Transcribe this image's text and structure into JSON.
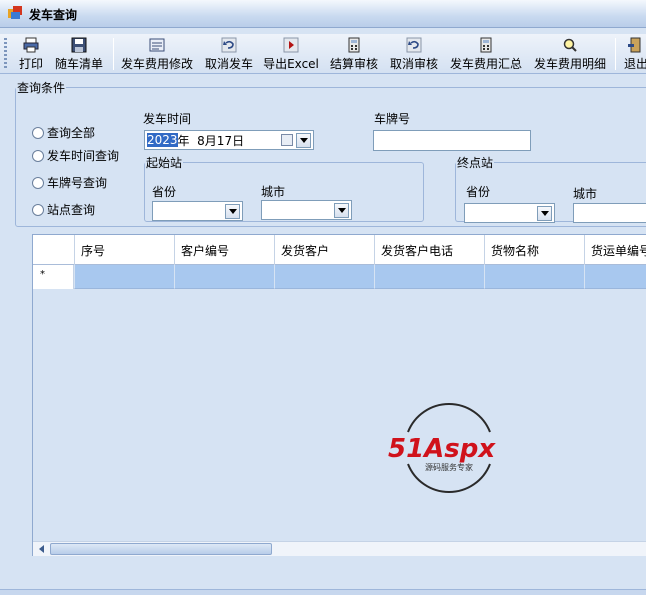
{
  "window": {
    "title": "发车查询",
    "icon": "app-icon"
  },
  "toolbar": {
    "items": [
      {
        "label": "打印",
        "icon": "printer-icon"
      },
      {
        "label": "随车清单",
        "icon": "floppy-disk-icon"
      },
      {
        "label": "发车费用修改",
        "icon": "edit-sheet-icon"
      },
      {
        "label": "取消发车",
        "icon": "undo-icon"
      },
      {
        "label": "导出Excel",
        "icon": "export-arrow-icon"
      },
      {
        "label": "结算审核",
        "icon": "calculator-icon"
      },
      {
        "label": "取消审核",
        "icon": "undo-icon"
      },
      {
        "label": "发车费用汇总",
        "icon": "calculator-icon"
      },
      {
        "label": "发车费用明细",
        "icon": "magnifier-icon"
      },
      {
        "label": "退出",
        "icon": "exit-door-icon"
      }
    ]
  },
  "query": {
    "legend": "查询条件",
    "radios": [
      "查询全部",
      "发车时间查询",
      "车牌号查询",
      "站点查询"
    ],
    "depart_time_label": "发车时间",
    "date_year_selected": "2023",
    "date_rest": "年  8月17日",
    "plate_label": "车牌号",
    "plate_value": "",
    "origin": {
      "legend": "起始站",
      "province_label": "省份",
      "city_label": "城市"
    },
    "destination": {
      "legend": "终点站",
      "province_label": "省份",
      "city_label": "城市"
    }
  },
  "grid": {
    "columns": [
      "序号",
      "客户编号",
      "发货客户",
      "发货客户电话",
      "货物名称",
      "货运单编号"
    ],
    "new_row_marker": "*"
  },
  "watermark": {
    "brand": "51Aspx",
    "tagline": "源码服务专家"
  },
  "colors": {
    "background": "#d6e3f3",
    "selected_row": "#a8c8ef",
    "selection_highlight": "#316ac5",
    "watermark_red": "#d0121b",
    "watermark_green": "#3aa935"
  }
}
